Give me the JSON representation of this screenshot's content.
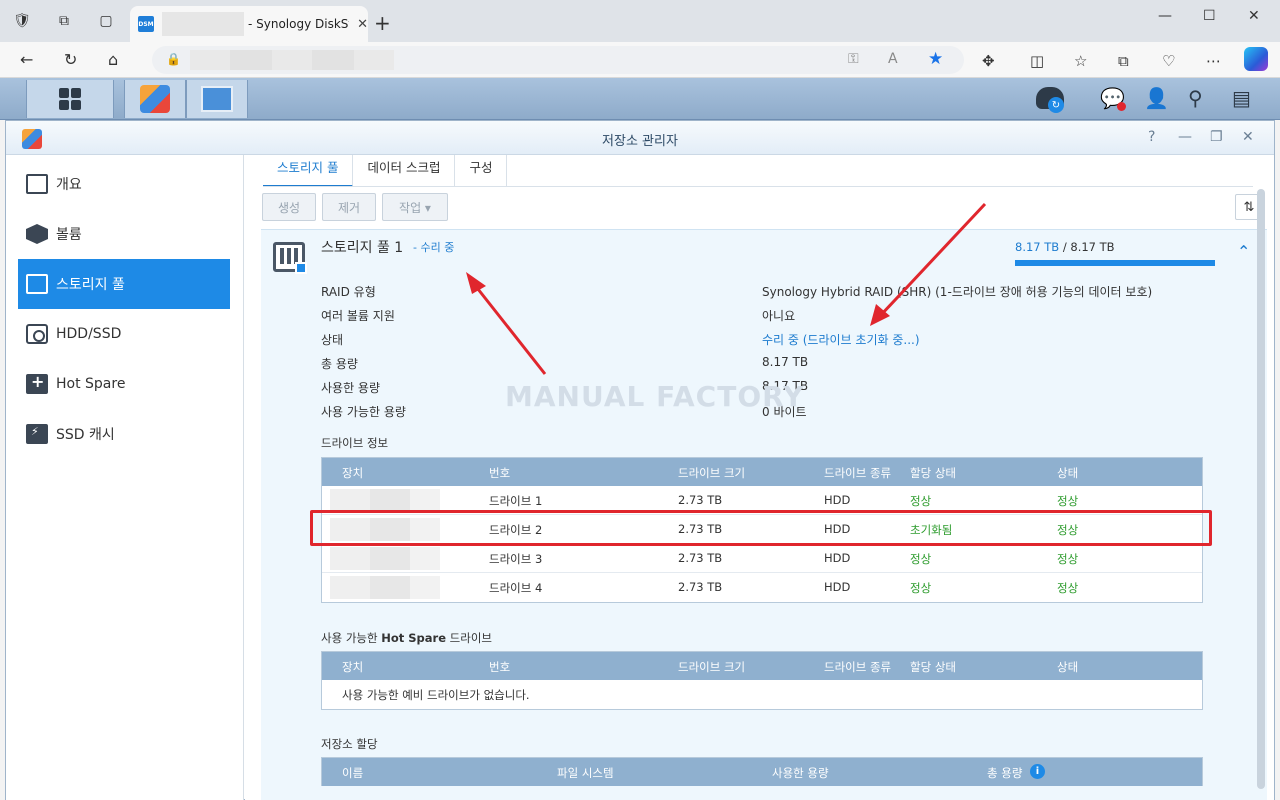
{
  "browser": {
    "tab_title": "- Synology DiskStation",
    "tab_favicon": "DSM",
    "new_tab": "+",
    "window_controls": [
      "—",
      "☐",
      "✕"
    ]
  },
  "dsm": {
    "window_title": "저장소 관리자",
    "window_buttons": [
      "?",
      "—",
      "❐",
      "✕"
    ]
  },
  "sidebar": {
    "items": [
      {
        "label": "개요",
        "icon": "overview-icon"
      },
      {
        "label": "볼륨",
        "icon": "volume-icon"
      },
      {
        "label": "스토리지 풀",
        "icon": "storage-pool-icon"
      },
      {
        "label": "HDD/SSD",
        "icon": "hdd-icon"
      },
      {
        "label": "Hot Spare",
        "icon": "hot-spare-icon"
      },
      {
        "label": "SSD 캐시",
        "icon": "ssd-cache-icon"
      }
    ],
    "selected": "스토리지 풀"
  },
  "tabs": [
    "스토리지 풀",
    "데이터 스크럽",
    "구성"
  ],
  "toolbar": {
    "create": "생성",
    "remove": "제거",
    "action": "작업 ▾"
  },
  "pool": {
    "title": "스토리지 풀 1",
    "status_suffix": "- 수리 중",
    "used_capacity": "8.17 TB",
    "total_capacity": "/ 8.17 TB",
    "usage_fraction": 1.0,
    "details": [
      {
        "label": "RAID 유형",
        "value": "Synology Hybrid RAID (SHR) (1-드라이브 장애 허용 기능의 데이터 보호)"
      },
      {
        "label": "여러 볼륨 지원",
        "value": "아니요"
      },
      {
        "label": "상태",
        "value": "수리 중 (드라이브 초기화 중...)",
        "link": true
      },
      {
        "label": "총 용량",
        "value": "8.17 TB"
      },
      {
        "label": "사용한 용량",
        "value": "8.17 TB"
      },
      {
        "label": "사용 가능한 용량",
        "value": "0 바이트"
      }
    ]
  },
  "watermark": "MANUAL FACTORY",
  "drive_info": {
    "title": "드라이브 정보",
    "headers": [
      "장치",
      "번호",
      "드라이브 크기",
      "드라이브 종류",
      "할당 상태",
      "상태"
    ],
    "rows": [
      {
        "number": "드라이브 1",
        "size": "2.73 TB",
        "type": "HDD",
        "alloc": "정상",
        "status": "정상"
      },
      {
        "number": "드라이브 2",
        "size": "2.73 TB",
        "type": "HDD",
        "alloc": "초기화됨",
        "status": "정상"
      },
      {
        "number": "드라이브 3",
        "size": "2.73 TB",
        "type": "HDD",
        "alloc": "정상",
        "status": "정상"
      },
      {
        "number": "드라이브 4",
        "size": "2.73 TB",
        "type": "HDD",
        "alloc": "정상",
        "status": "정상"
      }
    ]
  },
  "hot_spare": {
    "title_prefix": "사용 가능한",
    "title_bold": "Hot Spare",
    "title_suffix": "드라이브",
    "headers": [
      "장치",
      "번호",
      "드라이브 크기",
      "드라이브 종류",
      "할당 상태",
      "상태"
    ],
    "empty": "사용 가능한 예비 드라이브가 없습니다."
  },
  "allocation": {
    "title": "저장소 할당",
    "headers": [
      "이름",
      "파일 시스템",
      "사용한 용량",
      "총 용량"
    ]
  },
  "colors": {
    "accent": "#1e8ae6",
    "ok": "#2e9c2e",
    "annotation": "#e0262d"
  }
}
